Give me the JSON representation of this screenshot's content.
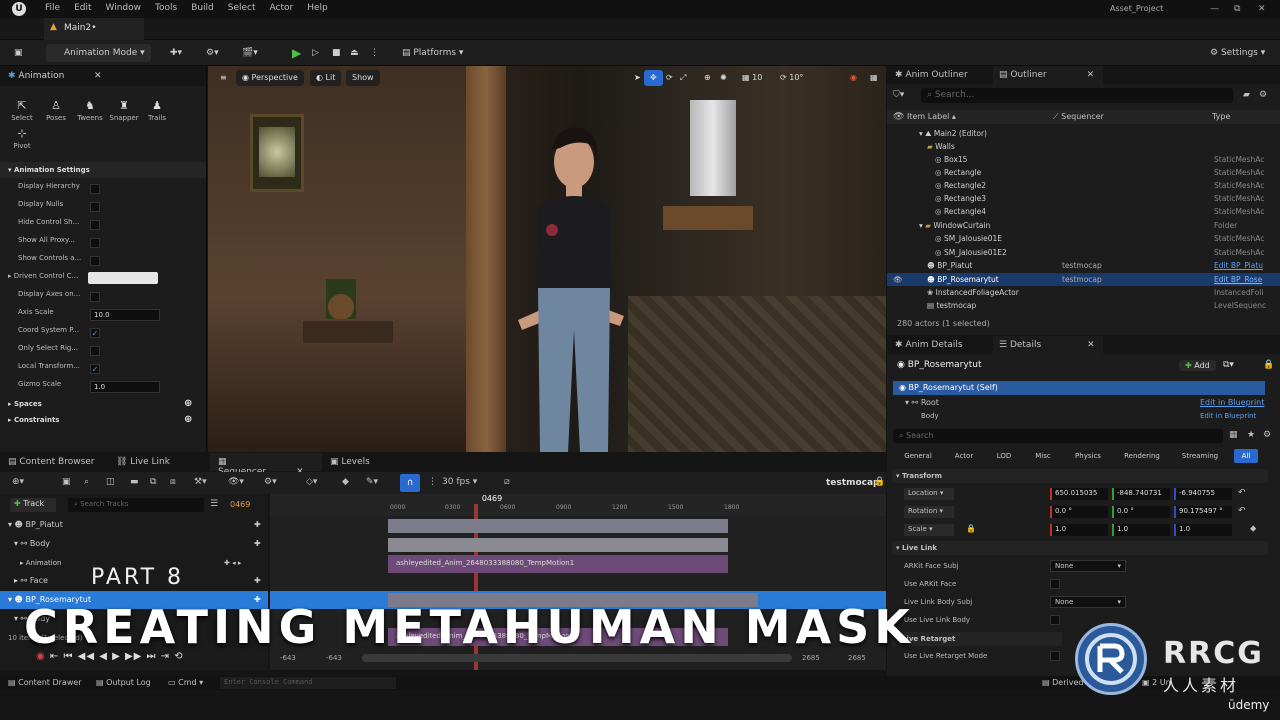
{
  "menubar": {
    "items": [
      "File",
      "Edit",
      "Window",
      "Tools",
      "Build",
      "Select",
      "Actor",
      "Help"
    ],
    "project": "Asset_Project",
    "win_controls": [
      "—",
      "⧉",
      "✕"
    ]
  },
  "tab": {
    "level": "Main2•"
  },
  "toolbar": {
    "mode": "Animation Mode",
    "platforms": "Platforms",
    "settings": "Settings"
  },
  "anim_panel": {
    "title": "Animation",
    "tools": [
      "Select",
      "Poses",
      "Tweens",
      "Snapper",
      "Trails",
      "Pivot"
    ],
    "settings_header": "Animation Settings",
    "props": [
      {
        "label": "Display Hierarchy",
        "kind": "check",
        "checked": false
      },
      {
        "label": "Display Nulls",
        "kind": "check",
        "checked": false
      },
      {
        "label": "Hide Control Sh...",
        "kind": "check",
        "checked": false
      },
      {
        "label": "Show All Proxy...",
        "kind": "check",
        "checked": false
      },
      {
        "label": "Show Controls a...",
        "kind": "check",
        "checked": false
      },
      {
        "label": "Driven Control C...",
        "kind": "color",
        "value": ""
      },
      {
        "label": "Display Axes on...",
        "kind": "check",
        "checked": false
      },
      {
        "label": "Axis Scale",
        "kind": "field",
        "value": "10.0"
      },
      {
        "label": "Coord System P...",
        "kind": "check",
        "checked": true
      },
      {
        "label": "Only Select Rig...",
        "kind": "check",
        "checked": false
      },
      {
        "label": "Local Transform...",
        "kind": "check",
        "checked": true
      },
      {
        "label": "Gizmo Scale",
        "kind": "field",
        "value": "1.0"
      }
    ],
    "spaces": "Spaces",
    "constraints": "Constraints"
  },
  "viewport": {
    "perspective": "Perspective",
    "lit": "Lit",
    "show": "Show",
    "grid": "10",
    "angle": "10°"
  },
  "outliner": {
    "tabs": [
      "Anim Outliner",
      "Outliner"
    ],
    "search_placeholder": "Search...",
    "columns": [
      "Item Label ▴",
      "Sequencer",
      "Type"
    ],
    "rows": [
      {
        "label": "Main2 (Editor)",
        "seq": "",
        "type": ""
      },
      {
        "label": "Walls",
        "seq": "",
        "type": ""
      },
      {
        "label": "Box15",
        "seq": "",
        "type": "StaticMeshAc"
      },
      {
        "label": "Rectangle",
        "seq": "",
        "type": "StaticMeshAc"
      },
      {
        "label": "Rectangle2",
        "seq": "",
        "type": "StaticMeshAc"
      },
      {
        "label": "Rectangle3",
        "seq": "",
        "type": "StaticMeshAc"
      },
      {
        "label": "Rectangle4",
        "seq": "",
        "type": "StaticMeshAc"
      },
      {
        "label": "WindowCurtain",
        "seq": "",
        "type": "Folder"
      },
      {
        "label": "SM_Jalousie01E",
        "seq": "",
        "type": "StaticMeshAc"
      },
      {
        "label": "SM_Jalousie01E2",
        "seq": "",
        "type": "StaticMeshAc"
      },
      {
        "label": "BP_Piatut",
        "seq": "testmocap",
        "type": "Edit BP_Piatu"
      },
      {
        "label": "BP_Rosemarytut",
        "seq": "testmocap",
        "type": "Edit BP_Rose"
      },
      {
        "label": "InstancedFoliageActor",
        "seq": "",
        "type": "InstancedFoli"
      },
      {
        "label": "testmocap",
        "seq": "",
        "type": "LevelSequenc"
      }
    ],
    "count": "280 actors (1 selected)"
  },
  "details": {
    "tabs": [
      "Anim Details",
      "Details"
    ],
    "actor": "BP_Rosemarytut",
    "add": "Add",
    "self": "BP_Rosemarytut (Self)",
    "root": "Root",
    "body": "Body",
    "edit_bp": "Edit in Blueprint",
    "search_placeholder": "Search",
    "categories": [
      "General",
      "Actor",
      "LOD",
      "Misc",
      "Physics",
      "Rendering",
      "Streaming",
      "All"
    ],
    "transform": "Transform",
    "location": {
      "label": "Location",
      "x": "650.015035",
      "y": "-848.740731",
      "z": "-6.940755"
    },
    "rotation": {
      "label": "Rotation",
      "x": "0.0 °",
      "y": "0.0 °",
      "z": "90.175497 °"
    },
    "scale": {
      "label": "Scale",
      "x": "1.0",
      "y": "1.0",
      "z": "1.0"
    },
    "livelink": "Live Link",
    "ll_props": [
      {
        "label": "ARKit Face Subj",
        "value": "None"
      },
      {
        "label": "Use ARKit Face",
        "value": ""
      },
      {
        "label": "Live Link Body Subj",
        "value": "None"
      },
      {
        "label": "Use Live Link Body",
        "value": ""
      }
    ],
    "retarget": "Live Retarget",
    "use_retarget": "Use Live Retarget Mode"
  },
  "bottom": {
    "tabs": [
      "Content Browser",
      "Live Link",
      "Sequencer",
      "Levels"
    ],
    "fps": "30 fps",
    "seq_name": "testmocap",
    "track_btn": "Track",
    "search_tracks": "Search Tracks",
    "frame": "0469",
    "tracks": [
      "BP_Piatut",
      "Body",
      "Animation",
      "Face",
      "BP_Rosemarytut",
      "Body"
    ],
    "clip1": "ashleyedited_Anim_2648033388080_TempMotion1",
    "clip2": "ashleyedited_Anim_2648033388080_TempMotion1",
    "items": "10 items (1 selected)",
    "start": "-643",
    "start2": "-643",
    "end": "2685",
    "end2": "2685",
    "ticks": [
      "0000",
      "0300",
      "0600",
      "0900",
      "1200",
      "1500",
      "1800"
    ]
  },
  "status": {
    "drawer": "Content Drawer",
    "output": "Output Log",
    "cmd": "Cmd",
    "console_placeholder": "Enter Console Command",
    "derived": "Derived Data",
    "unsaved": "2 Un"
  },
  "overlay": {
    "part": "PART 8",
    "title": "CREATING METAHUMAN MASK"
  },
  "watermark": {
    "brand": "RRCG",
    "sub": "人人素材",
    "udemy": "ūdemy"
  }
}
